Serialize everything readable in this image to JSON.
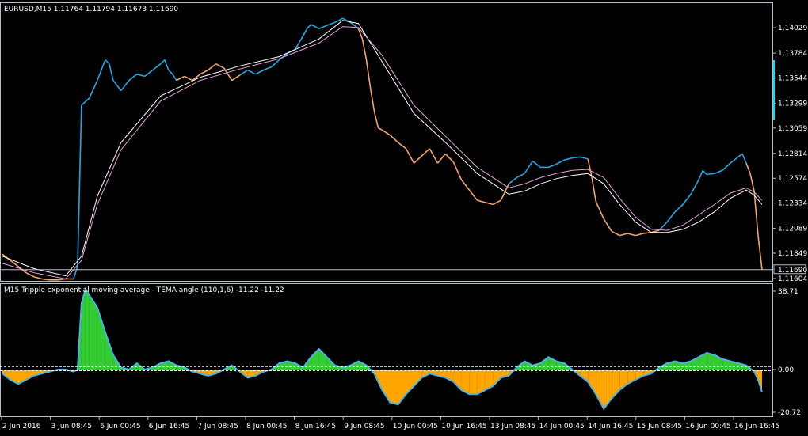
{
  "colors": {
    "background": "#000000",
    "axis": "#b4c0c8",
    "text": "#ffffff",
    "price_up": "#1ea8e6",
    "price_down": "#f4a468",
    "ma_white": "#ffffff",
    "ma_pink": "#e8a0e0",
    "osc_pos": "#33cc33",
    "osc_neg": "#ffa500",
    "osc_line": "#4ab4e8"
  },
  "chart_data": [
    {
      "type": "line",
      "title": "EURUSD,M15  1.11764 1.11794 1.11673 1.11690",
      "ylim": [
        1.11604,
        1.14129
      ],
      "y_ticks": [
        "1.14029",
        "1.13784",
        "1.13544",
        "1.13299",
        "1.13059",
        "1.12814",
        "1.12574",
        "1.12334",
        "1.12089",
        "1.11849",
        "1.11604"
      ],
      "y_tick_values": [
        1.14029,
        1.13784,
        1.13544,
        1.13299,
        1.13059,
        1.12814,
        1.12574,
        1.12334,
        1.12089,
        1.11849,
        1.11604
      ],
      "current_price_label": "1.11690",
      "current_price": 1.1169,
      "series": [
        {
          "role": "price",
          "x": [
            0,
            10,
            20,
            30,
            40,
            50,
            60,
            70,
            80,
            90,
            95,
            100,
            110,
            120,
            125,
            130,
            135,
            140,
            150,
            160,
            170,
            180,
            190,
            200,
            205,
            210,
            215,
            220,
            230,
            240,
            250,
            260,
            270,
            280,
            290,
            300,
            310,
            320,
            330,
            340,
            350,
            360,
            370,
            380,
            385,
            390,
            400,
            410,
            420,
            430,
            440,
            450,
            455,
            460,
            465,
            470,
            475,
            480,
            490,
            500,
            510,
            520,
            530,
            540,
            550,
            560,
            570,
            580,
            590,
            600,
            610,
            620,
            630,
            640,
            650,
            660,
            670,
            680,
            690,
            700,
            710,
            720,
            730,
            740,
            745,
            750,
            760,
            770,
            780,
            790,
            800,
            810,
            820,
            830,
            840,
            850,
            860,
            870,
            880,
            885,
            890,
            900,
            910,
            920,
            930,
            935,
            940,
            945,
            950,
            955,
            960
          ],
          "y": [
            1.1184,
            1.1178,
            1.1172,
            1.1166,
            1.1162,
            1.116,
            1.1159,
            1.1159,
            1.116,
            1.116,
            1.1172,
            1.1328,
            1.1335,
            1.1352,
            1.1362,
            1.1372,
            1.1368,
            1.1352,
            1.1342,
            1.1352,
            1.1358,
            1.1356,
            1.1362,
            1.1368,
            1.1372,
            1.1362,
            1.1358,
            1.1352,
            1.1356,
            1.1352,
            1.1358,
            1.1362,
            1.1368,
            1.1364,
            1.1352,
            1.1357,
            1.1362,
            1.1358,
            1.1362,
            1.1365,
            1.1372,
            1.1378,
            1.1382,
            1.1395,
            1.1402,
            1.1406,
            1.1402,
            1.1405,
            1.1408,
            1.1412,
            1.1408,
            1.1402,
            1.1392,
            1.1372,
            1.1345,
            1.1322,
            1.1306,
            1.1304,
            1.1299,
            1.1292,
            1.1286,
            1.1272,
            1.1279,
            1.1286,
            1.1272,
            1.1281,
            1.1273,
            1.1256,
            1.1246,
            1.1236,
            1.1234,
            1.1232,
            1.1236,
            1.1252,
            1.1258,
            1.1262,
            1.1274,
            1.1268,
            1.1268,
            1.1271,
            1.1275,
            1.1277,
            1.1278,
            1.1276,
            1.1258,
            1.1235,
            1.1218,
            1.1206,
            1.1202,
            1.1204,
            1.1202,
            1.1204,
            1.1205,
            1.1207,
            1.1215,
            1.1225,
            1.1232,
            1.1242,
            1.1256,
            1.1265,
            1.1261,
            1.1262,
            1.1265,
            1.1272,
            1.1278,
            1.1281,
            1.1272,
            1.1262,
            1.1245,
            1.1202,
            1.1169
          ],
          "down_ranges": [
            [
              0,
              90
            ],
            [
              220,
              300
            ],
            [
              450,
              640
            ],
            [
              740,
              830
            ],
            [
              940,
              960
            ]
          ]
        },
        {
          "role": "ma-white",
          "x": [
            0,
            40,
            80,
            100,
            120,
            150,
            200,
            250,
            300,
            350,
            400,
            430,
            450,
            480,
            520,
            560,
            600,
            640,
            660,
            680,
            700,
            720,
            740,
            760,
            780,
            800,
            820,
            840,
            860,
            880,
            900,
            920,
            940,
            950,
            960
          ],
          "y": [
            1.1182,
            1.117,
            1.1163,
            1.1182,
            1.124,
            1.1292,
            1.1337,
            1.1355,
            1.1366,
            1.1375,
            1.1392,
            1.141,
            1.1407,
            1.137,
            1.132,
            1.1292,
            1.1262,
            1.1242,
            1.1245,
            1.1252,
            1.1257,
            1.126,
            1.1262,
            1.1252,
            1.1232,
            1.1215,
            1.1205,
            1.1205,
            1.1208,
            1.1215,
            1.1225,
            1.1238,
            1.1246,
            1.1241,
            1.1232
          ]
        },
        {
          "role": "ma-pink",
          "x": [
            0,
            40,
            80,
            100,
            120,
            150,
            200,
            250,
            300,
            350,
            400,
            430,
            450,
            480,
            520,
            560,
            600,
            640,
            660,
            680,
            700,
            720,
            740,
            760,
            780,
            800,
            820,
            840,
            860,
            880,
            900,
            920,
            940,
            950,
            960
          ],
          "y": [
            1.1175,
            1.1166,
            1.116,
            1.1178,
            1.1232,
            1.1285,
            1.1332,
            1.1352,
            1.1363,
            1.1373,
            1.1388,
            1.1404,
            1.1403,
            1.1376,
            1.1328,
            1.1298,
            1.1268,
            1.1248,
            1.1252,
            1.1258,
            1.1262,
            1.1265,
            1.1266,
            1.1258,
            1.1238,
            1.122,
            1.1208,
            1.1207,
            1.1212,
            1.1222,
            1.1232,
            1.1243,
            1.1248,
            1.1244,
            1.1236
          ]
        }
      ]
    },
    {
      "type": "area",
      "title": "M15 Tripple exponential moving average - TEMA angle (110,1,6) -11.22 -11.22",
      "ylim": [
        -20.72,
        38.71
      ],
      "y_ticks": [
        "38.71",
        "0.00",
        "-20.72"
      ],
      "y_tick_values": [
        38.71,
        0,
        -20.72
      ],
      "zero_level": 0,
      "level_dashes": [
        1.4,
        -0.6
      ],
      "series": [
        {
          "role": "tema-angle",
          "x": [
            0,
            10,
            20,
            30,
            40,
            50,
            60,
            70,
            80,
            90,
            95,
            100,
            105,
            110,
            120,
            130,
            140,
            150,
            160,
            170,
            180,
            190,
            200,
            210,
            220,
            230,
            240,
            250,
            260,
            270,
            280,
            290,
            300,
            310,
            320,
            330,
            340,
            350,
            360,
            370,
            380,
            390,
            400,
            410,
            420,
            430,
            440,
            450,
            460,
            470,
            480,
            490,
            500,
            510,
            520,
            530,
            540,
            550,
            560,
            570,
            580,
            590,
            600,
            610,
            620,
            630,
            640,
            650,
            660,
            670,
            680,
            690,
            700,
            710,
            720,
            730,
            740,
            750,
            760,
            770,
            780,
            790,
            800,
            810,
            820,
            830,
            840,
            850,
            860,
            870,
            880,
            890,
            900,
            910,
            920,
            930,
            940,
            950,
            955,
            960
          ],
          "y": [
            -2,
            -5,
            -7,
            -5,
            -3,
            -2,
            -1,
            0,
            0,
            -1,
            0,
            32,
            39,
            36,
            30,
            18,
            7,
            1,
            0,
            3,
            0,
            1,
            3,
            4,
            2,
            1,
            -1,
            -2,
            -3,
            -2,
            0,
            2,
            -1,
            -4,
            -3,
            -1,
            0,
            3,
            4,
            3,
            1,
            6,
            10,
            6,
            2,
            1,
            2,
            4,
            2,
            -2,
            -10,
            -16,
            -17,
            -12,
            -8,
            -4,
            -2,
            -3,
            -4,
            -6,
            -10,
            -12,
            -12,
            -10,
            -8,
            -4,
            -3,
            1,
            4,
            2,
            3,
            6,
            4,
            3,
            0,
            -3,
            -6,
            -12,
            -19,
            -14,
            -10,
            -7,
            -5,
            -3,
            -2,
            1,
            3,
            4,
            3,
            4,
            6,
            8,
            7,
            5,
            4,
            3,
            2,
            -1,
            -5,
            -11
          ]
        }
      ]
    }
  ],
  "x_axis": {
    "tick_labels": [
      "2 Jun 2016",
      "3 Jun 08:45",
      "6 Jun 00:45",
      "6 Jun 16:45",
      "7 Jun 08:45",
      "8 Jun 00:45",
      "8 Jun 16:45",
      "9 Jun 08:45",
      "10 Jun 00:45",
      "10 Jun 16:45",
      "13 Jun 08:45",
      "14 Jun 00:45",
      "14 Jun 16:45",
      "15 Jun 08:45",
      "16 Jun 00:45",
      "16 Jun 16:45"
    ]
  }
}
